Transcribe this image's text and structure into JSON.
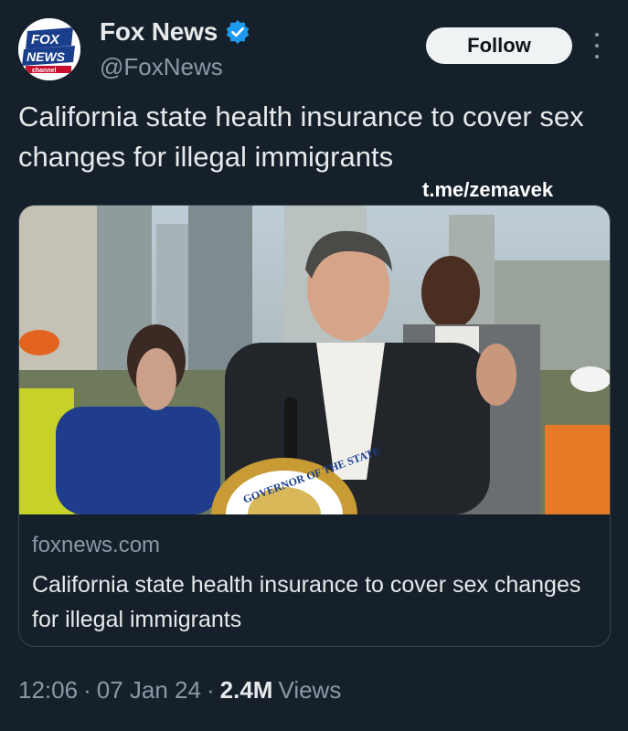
{
  "author": {
    "name": "Fox News",
    "handle": "@FoxNews",
    "verified": true,
    "avatar_logo_text": [
      "FOX",
      "NEWS",
      "channel"
    ]
  },
  "header": {
    "follow_label": "Follow",
    "more_icon": "more-vertical-icon"
  },
  "tweet": {
    "text": "California state health insurance to cover sex changes for illegal immigrants",
    "watermark": "t.me/zemavek"
  },
  "card": {
    "image_seal_text": "GOVERNOR OF THE STATE OF CALIFORNIA",
    "domain": "foxnews.com",
    "title": "California state health insurance to cover sex changes for illegal immigrants"
  },
  "meta": {
    "time": "12:06",
    "date": "07 Jan 24",
    "views_count": "2.4M",
    "views_label": "Views",
    "separator": "·"
  },
  "colors": {
    "background": "#15202b",
    "verified_badge": "#1d9bf0",
    "secondary_text": "#8b98a5",
    "follow_bg": "#eff3f4"
  }
}
